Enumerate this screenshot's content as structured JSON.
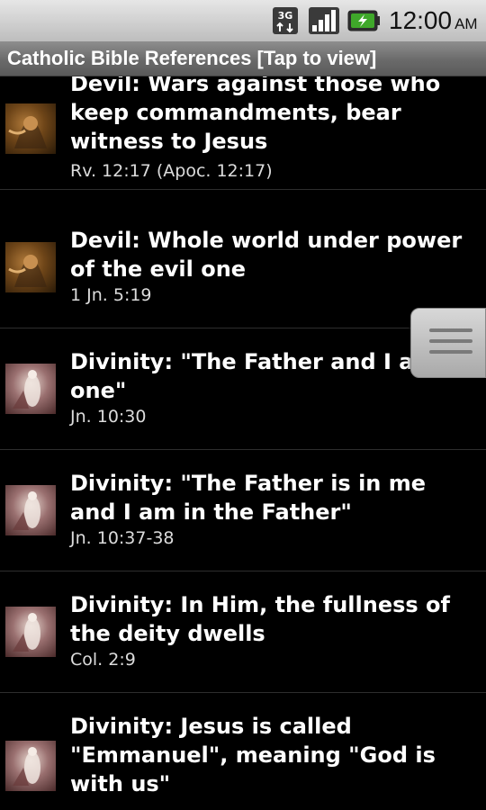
{
  "status_bar": {
    "network": "3G",
    "time": "12:00",
    "ampm": "AM",
    "icons": [
      "3g-data-icon",
      "signal-strength-icon",
      "battery-charging-icon"
    ]
  },
  "title_bar": {
    "title": "Catholic Bible References  [Tap to view]"
  },
  "list": {
    "items": [
      {
        "title": "Devil: Wars against those who keep commandments, bear witness to Jesus",
        "reference": "Rv. 12:17 (Apoc. 12:17)",
        "thumbnail": "devil"
      },
      {
        "title": "Devil: Whole world under power of the evil one",
        "reference": "1 Jn. 5:19",
        "thumbnail": "devil"
      },
      {
        "title": "Divinity: \"The Father and I are one\"",
        "reference": "Jn. 10:30",
        "thumbnail": "angel"
      },
      {
        "title": "Divinity: \"The Father is in me and I am in the Father\"",
        "reference": "Jn. 10:37-38",
        "thumbnail": "angel"
      },
      {
        "title": "Divinity: In Him, the fullness of the deity dwells",
        "reference": "Col. 2:9",
        "thumbnail": "angel"
      },
      {
        "title": "Divinity: Jesus is called \"Emmanuel\", meaning \"God is with us\"",
        "reference": "",
        "thumbnail": "angel"
      }
    ]
  },
  "colors": {
    "background": "#000000",
    "title_bar": "#6a6a6a",
    "status_bar": "#cfcfcf",
    "reference_text": "#dcdcdc",
    "battery": "#3fa82a"
  }
}
